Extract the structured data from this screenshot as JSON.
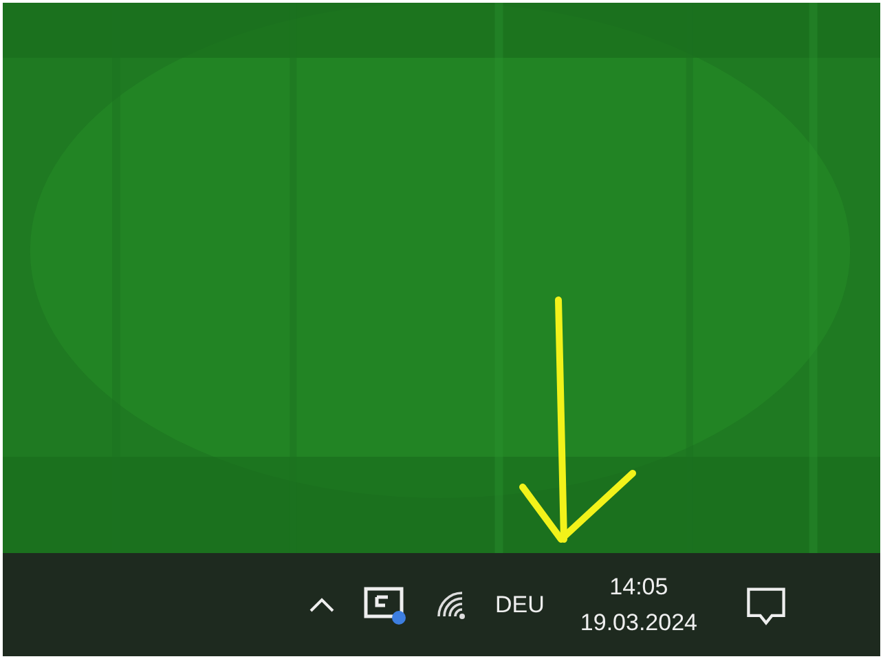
{
  "taskbar": {
    "language": "DEU",
    "clock": {
      "time": "14:05",
      "date": "19.03.2024"
    }
  }
}
